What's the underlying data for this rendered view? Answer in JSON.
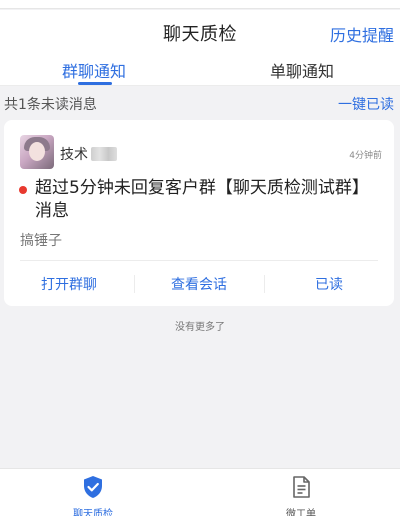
{
  "header": {
    "title": "聊天质检",
    "right_action": "历史提醒"
  },
  "tabs": [
    {
      "label": "群聊通知",
      "active": true
    },
    {
      "label": "单聊通知",
      "active": false
    }
  ],
  "summary": {
    "unread_text": "共1条未读消息",
    "mark_all_read": "一键已读"
  },
  "notification": {
    "sender": "技术",
    "time": "4分钟前",
    "message": "超过5分钟未回复客户群【聊天质检测试群】消息",
    "subtitle": "搞锤子",
    "actions": [
      "打开群聊",
      "查看会话",
      "已读"
    ]
  },
  "footer_text": "没有更多了",
  "bottom_nav": [
    {
      "label": "聊天质检",
      "icon": "shield-check-icon",
      "active": true
    },
    {
      "label": "微工单",
      "icon": "document-icon",
      "active": false
    }
  ],
  "colors": {
    "accent": "#2f6fe0",
    "unread_dot": "#e8392f",
    "background": "#f2f2f4"
  }
}
